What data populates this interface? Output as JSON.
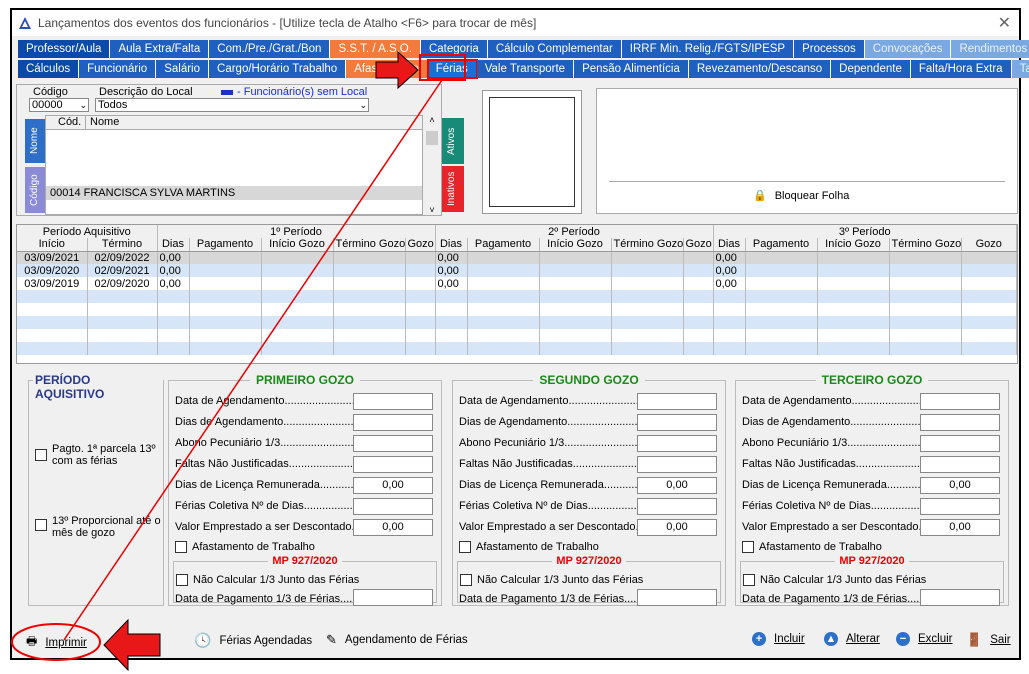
{
  "window": {
    "title": "Lançamentos dos eventos dos funcionários - [Utilize tecla de Atalho <F6> para trocar de mês]"
  },
  "tabs_row1": [
    {
      "label": "Professor/Aula",
      "style": "dark"
    },
    {
      "label": "Aula Extra/Falta",
      "style": "blue"
    },
    {
      "label": "Com./Pre./Grat./Bon",
      "style": "blue"
    },
    {
      "label": "S.S.T. / A.S.O.",
      "style": "orange"
    },
    {
      "label": "Categoria",
      "style": "blue"
    },
    {
      "label": "Cálculo Complementar",
      "style": "blue"
    },
    {
      "label": "IRRF Min. Relig./FGTS/IPESP",
      "style": "blue"
    },
    {
      "label": "Processos",
      "style": "blue"
    },
    {
      "label": "Convocações",
      "style": "light"
    },
    {
      "label": "Rendimentos",
      "style": "light"
    }
  ],
  "tabs_row2": [
    {
      "label": "Cálculos",
      "style": "dark"
    },
    {
      "label": "Funcionário",
      "style": "blue"
    },
    {
      "label": "Salário",
      "style": "blue"
    },
    {
      "label": "Cargo/Horário Trabalho",
      "style": "blue"
    },
    {
      "label": "Afastamento",
      "style": "orange"
    },
    {
      "label": "Férias",
      "style": "active"
    },
    {
      "label": "Vale Transporte",
      "style": "blue"
    },
    {
      "label": "Pensão Alimentícia",
      "style": "blue"
    },
    {
      "label": "Revezamento/Descanso",
      "style": "blue"
    },
    {
      "label": "Dependente",
      "style": "blue"
    },
    {
      "label": "Falta/Hora Extra",
      "style": "blue"
    },
    {
      "label": "Tarefa",
      "style": "light"
    }
  ],
  "selector": {
    "codigo_label": "Código",
    "descricao_label": "Descrição do Local",
    "legend": "- Funcionário(s) sem Local",
    "codigo_value": "00000",
    "descricao_value": "Todos",
    "col_cod": "Cód.",
    "col_nome": "Nome",
    "tab_nome": "Nome",
    "tab_codigo": "Código",
    "tab_ativos": "Ativos",
    "tab_inativos": "Inativos",
    "employee": "00014  FRANCISCA SYLVA MARTINS"
  },
  "bloquear_folha": "Bloquear Folha",
  "grid": {
    "h_periodo_aquisitivo": "Período Aquisitivo",
    "h_p1": "1º Período",
    "h_p2": "2º Período",
    "h_p3": "3º Período",
    "h_inicio": "Início",
    "h_termino": "Término",
    "h_dias": "Dias",
    "h_pagamento": "Pagamento",
    "h_inicio_gozo": "Início Gozo",
    "h_termino_gozo": "Término Gozo",
    "h_gozo": "Gozo",
    "rows": [
      {
        "inicio": "03/09/2021",
        "termino": "02/09/2022",
        "d1": "0,00",
        "d2": "0,00",
        "d3": "0,00"
      },
      {
        "inicio": "03/09/2020",
        "termino": "02/09/2021",
        "d1": "0,00",
        "d2": "0,00",
        "d3": "0,00"
      },
      {
        "inicio": "03/09/2019",
        "termino": "02/09/2020",
        "d1": "0,00",
        "d2": "0,00",
        "d3": "0,00"
      }
    ]
  },
  "periodo": {
    "title": "PERÍODO AQUISITIVO",
    "chk1": "Pagto. 1ª parcela 13º com as férias",
    "chk2": "13º Proporcional até o mês de gozo"
  },
  "gozo_labels": {
    "agendamento": "Data de Agendamento.........................",
    "dias_agendamento": "Dias de Agendamento.........................",
    "abono": "Abono Pecuniário 1/3.........................",
    "faltas": "Faltas Não Justificadas.........................",
    "licenca": "Dias de Licença Remunerada.........................",
    "coletiva": "Férias Coletiva Nº de Dias.........................",
    "emprestado": "Valor Emprestado a ser Descontado..",
    "afastamento": "Afastamento de Trabalho",
    "mp": "MP 927/2020",
    "nao_calcular": "Não Calcular 1/3 Junto das Férias",
    "data_pagamento": "Data de Pagamento 1/3 de Férias.........",
    "zero": "0,00"
  },
  "gozos": [
    {
      "title": "PRIMEIRO GOZO"
    },
    {
      "title": "SEGUNDO GOZO"
    },
    {
      "title": "TERCEIRO GOZO"
    }
  ],
  "footer": {
    "imprimir": "Imprimir",
    "ferias_agendadas": "Férias Agendadas",
    "agendamento_ferias": "Agendamento de Férias",
    "incluir": "Incluir",
    "alterar": "Alterar",
    "excluir": "Excluir",
    "sair": "Sair"
  },
  "colors": {
    "tab_blue": "#1f5fc0",
    "tab_orange": "#f27a3a",
    "gozo_title": "#1a8a1a",
    "mp_red": "#e00000",
    "annotation_red": "#e00000"
  }
}
